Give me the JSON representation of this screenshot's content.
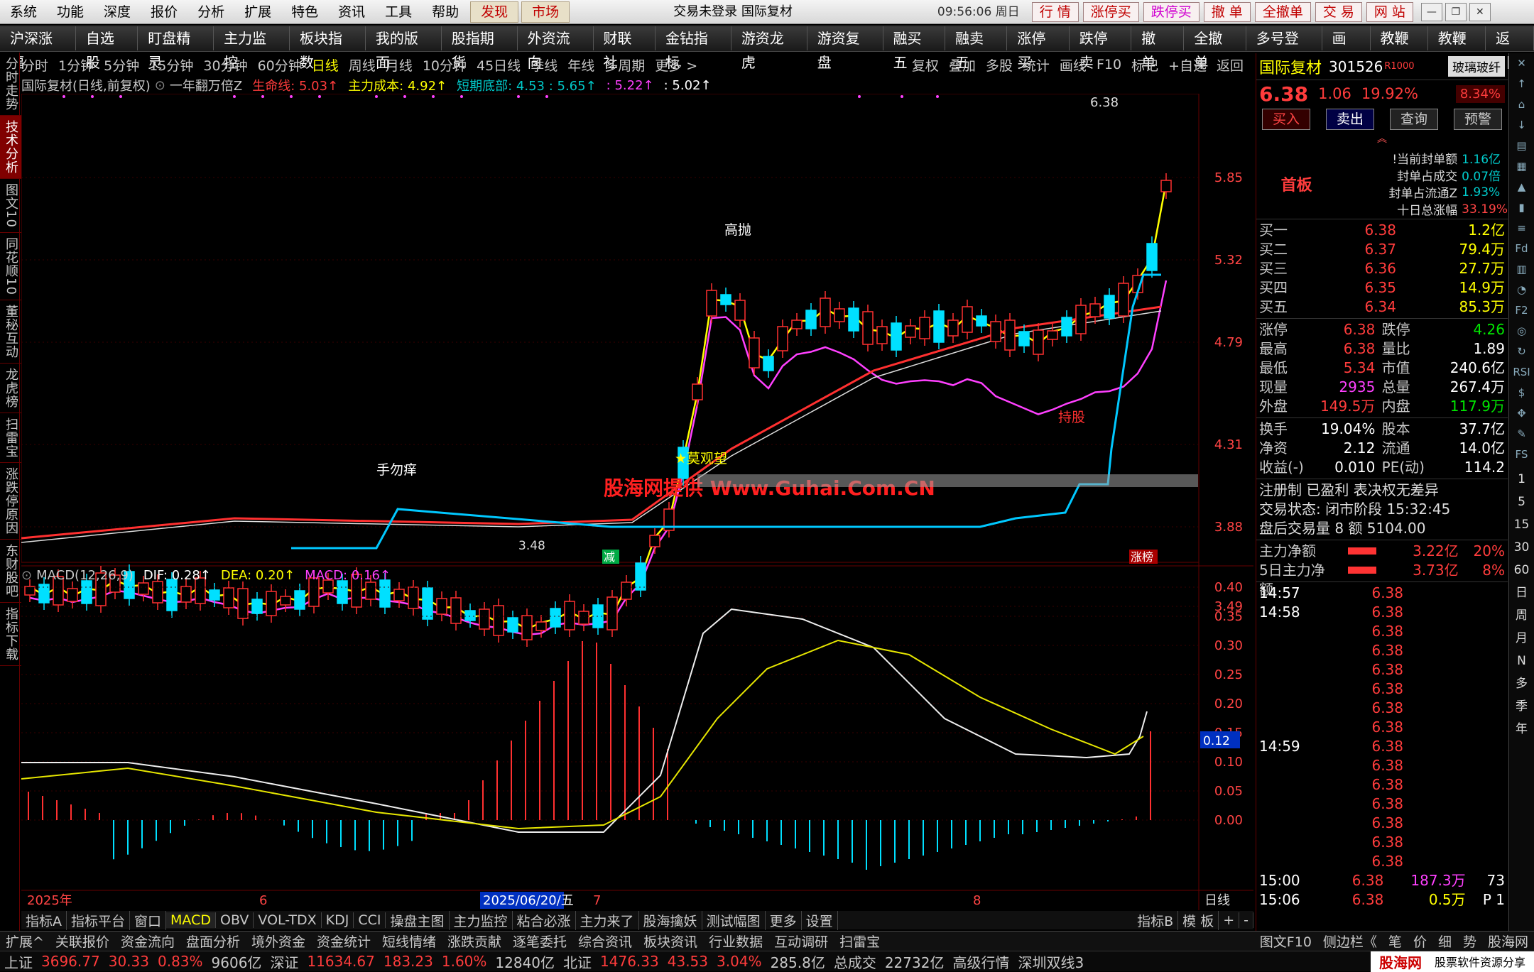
{
  "menubar": {
    "items": [
      "系统",
      "功能",
      "深度",
      "报价",
      "分析",
      "扩展",
      "特色",
      "资讯",
      "工具",
      "帮助"
    ],
    "highlight": [
      "发现",
      "市场"
    ],
    "title": "交易未登录  国际复材",
    "clock": "09:56:06 周日",
    "quick": [
      "行 情",
      "涨停买",
      "跌停买",
      "撤 单",
      "全撤单",
      "交 易",
      "网 站"
    ]
  },
  "toolbar": [
    "沪深涨幅",
    "自选股",
    "盯盘精灵",
    "主力监控",
    "板块指数",
    "我的版面",
    "股指期货",
    "外资流向",
    "财联社",
    "金钻指标",
    "游资龙虎",
    "游资复盘",
    "融买五",
    "融卖五",
    "涨停买",
    "跌停卖",
    "撤 单",
    "全撤单",
    "多号登录",
    "画线",
    "教鞭A",
    "教鞭B",
    "返回"
  ],
  "lefttabs": [
    "分时走势",
    "技术分析",
    "图文10",
    "同花顺10",
    "董秘互动",
    "龙虎榜",
    "扫雷宝",
    "涨跌停原因",
    "东财股吧",
    "指标下载"
  ],
  "periodbar": {
    "left": [
      "分时",
      "1分钟",
      "5分钟",
      "15分钟",
      "30分钟",
      "60分钟",
      "日线",
      "周线",
      "月线",
      "10分钟",
      "45日线",
      "季线",
      "年线",
      "多周期",
      "更多 >"
    ],
    "right": [
      "复权",
      "叠加",
      "多股",
      "统计",
      "画线",
      "F10",
      "标记",
      "+自选",
      "返回"
    ]
  },
  "chartinfo": {
    "name": "国际复材(日线,前复权)",
    "indicator": "一年翻万倍Z",
    "lifeline": "生命线: 5.03↑",
    "cost": "主力成本: 4.92↑",
    "bottom": "短期底部: 4.53 : 5.65↑",
    "v1": ": 5.22↑",
    "v2": ": 5.02↑"
  },
  "macdinfo": {
    "name": "MACD(12,26,9)",
    "dif": "DIF: 0.28↑",
    "dea": "DEA: 0.20↑",
    "macd": "MACD: 0.16↑"
  },
  "stock": {
    "name": "国际复材",
    "code": "301526",
    "tag": "R1000",
    "sector": "玻璃玻纤",
    "price": "6.38",
    "change": "1.06",
    "pct": "19.92%",
    "sector_pct": "8.34%"
  },
  "actions": [
    "买入",
    "卖出",
    "查询",
    "预警"
  ],
  "board": {
    "label": "首板",
    "rows": [
      [
        "!当前封单额",
        "1.16亿"
      ],
      [
        "封单占成交",
        "0.07倍"
      ],
      [
        "封单占流通Z",
        "1.93%"
      ],
      [
        "十日总涨幅",
        "33.19%"
      ]
    ]
  },
  "orderbook": [
    [
      "买一",
      "6.38",
      "1.2亿"
    ],
    [
      "买二",
      "6.37",
      "79.4万"
    ],
    [
      "买三",
      "6.36",
      "27.7万"
    ],
    [
      "买四",
      "6.35",
      "14.9万"
    ],
    [
      "买五",
      "6.34",
      "85.3万"
    ]
  ],
  "quotes": [
    [
      "涨停",
      "6.38",
      "跌停",
      "4.26"
    ],
    [
      "最高",
      "6.38",
      "量比",
      "1.89"
    ],
    [
      "最低",
      "5.34",
      "市值",
      "240.6亿"
    ],
    [
      "现量",
      "2935",
      "总量",
      "267.4万"
    ],
    [
      "外盘",
      "149.5万",
      "内盘",
      "117.9万"
    ]
  ],
  "fundamentals": [
    [
      "换手",
      "19.04%",
      "股本",
      "37.7亿"
    ],
    [
      "净资",
      "2.12",
      "流通",
      "14.0亿"
    ],
    [
      "收益(-)",
      "0.010",
      "PE(动)",
      "114.2"
    ]
  ],
  "notes": [
    "注册制 已盈利 表决权无差异",
    "交易状态: 闭市阶段 15:32:45",
    "盘后交易量 8 额 5104.00"
  ],
  "flows": [
    [
      "主力净额",
      "3.22亿",
      "20%"
    ],
    [
      "5日主力净额",
      "3.73亿",
      "8%"
    ]
  ],
  "ticks": [
    [
      "14:57",
      "6.38",
      ""
    ],
    [
      "14:58",
      "6.38",
      ""
    ],
    [
      "",
      "6.38",
      ""
    ],
    [
      "",
      "6.38",
      ""
    ],
    [
      "",
      "6.38",
      ""
    ],
    [
      "",
      "6.38",
      ""
    ],
    [
      "",
      "6.38",
      ""
    ],
    [
      "",
      "6.38",
      ""
    ],
    [
      "14:59",
      "6.38",
      ""
    ],
    [
      "",
      "6.38",
      ""
    ],
    [
      "",
      "6.38",
      ""
    ],
    [
      "",
      "6.38",
      ""
    ],
    [
      "",
      "6.38",
      ""
    ],
    [
      "",
      "6.38",
      ""
    ],
    [
      "",
      "6.38",
      ""
    ],
    [
      "15:00",
      "6.38",
      "187.3万"
    ],
    [
      "15:06",
      "6.38",
      "0.5万"
    ]
  ],
  "tick_extra": [
    [
      "73"
    ],
    [
      "P 1"
    ]
  ],
  "rightstrip": [
    "1",
    "5",
    "15",
    "30",
    "60",
    "日",
    "周",
    "月",
    "N",
    "多",
    "季",
    "年"
  ],
  "bottomtabs": [
    "指标A",
    "指标平台",
    "窗口",
    "MACD",
    "OBV",
    "VOL-TDX",
    "KDJ",
    "CCI",
    "操盘主图",
    "主力监控",
    "粘合必涨",
    "主力来了",
    "股海擒妖",
    "测试幅图",
    "更多",
    "设置"
  ],
  "bottomtabs_right": [
    "指标B",
    "模 板",
    "+",
    "-"
  ],
  "statusbar1": [
    "扩展^",
    "关联报价",
    "资金流向",
    "盘面分析",
    "境外资金",
    "资金统计",
    "短线情绪",
    "涨跌贡献",
    "逐笔委托",
    "综合资讯",
    "板块资讯",
    "行业数据",
    "互动调研",
    "扫雷宝"
  ],
  "statusbar1_right": [
    "图文F10",
    "侧边栏《",
    "笔",
    "价",
    "细",
    "势",
    "股海网"
  ],
  "statusbar2": [
    {
      "t": "上证",
      "c": "#c8c8c8"
    },
    {
      "t": "3696.77",
      "c": "#ff3c3c"
    },
    {
      "t": "30.33",
      "c": "#ff3c3c"
    },
    {
      "t": "0.83%",
      "c": "#ff3c3c"
    },
    {
      "t": "9606亿",
      "c": "#c8c8c8"
    },
    {
      "t": "深证",
      "c": "#c8c8c8"
    },
    {
      "t": "11634.67",
      "c": "#ff3c3c"
    },
    {
      "t": "183.23",
      "c": "#ff3c3c"
    },
    {
      "t": "1.60%",
      "c": "#ff3c3c"
    },
    {
      "t": "12840亿",
      "c": "#c8c8c8"
    },
    {
      "t": "北证",
      "c": "#c8c8c8"
    },
    {
      "t": "1476.33",
      "c": "#ff3c3c"
    },
    {
      "t": "43.53",
      "c": "#ff3c3c"
    },
    {
      "t": "3.04%",
      "c": "#ff3c3c"
    },
    {
      "t": "285.8亿",
      "c": "#c8c8c8"
    },
    {
      "t": "总成交",
      "c": "#c8c8c8"
    },
    {
      "t": "22732亿",
      "c": "#c8c8c8"
    },
    {
      "t": "高级行情",
      "c": "#c8c8c8"
    },
    {
      "t": "深圳双线3",
      "c": "#c8c8c8"
    }
  ],
  "watermark": "股海网提供 Www.Guhai.Com.CN",
  "corner_watermark": [
    "股海网",
    "股票软件资源分享",
    "www.Guhai.com.cn"
  ],
  "chart_data": {
    "type": "candlestick",
    "price_axis": [
      "5.85",
      "5.32",
      "4.79",
      "4.31",
      "3.88",
      "3.49"
    ],
    "macd_axis": [
      "0.40",
      "0.35",
      "0.30",
      "0.25",
      "0.20",
      "0.15",
      "0.10",
      "0.05",
      "0.00"
    ],
    "date_labels": [
      "2025年",
      "6",
      "2025/06/20/五",
      "7",
      "8"
    ],
    "annotations": [
      "高抛",
      "手勿痒",
      "★莫观望",
      "持股",
      "6.38",
      "3.48",
      "减",
      "涨榜"
    ],
    "macd_cursor": "0.12",
    "corner_label": "日线",
    "high": 6.38,
    "low": 3.48
  }
}
